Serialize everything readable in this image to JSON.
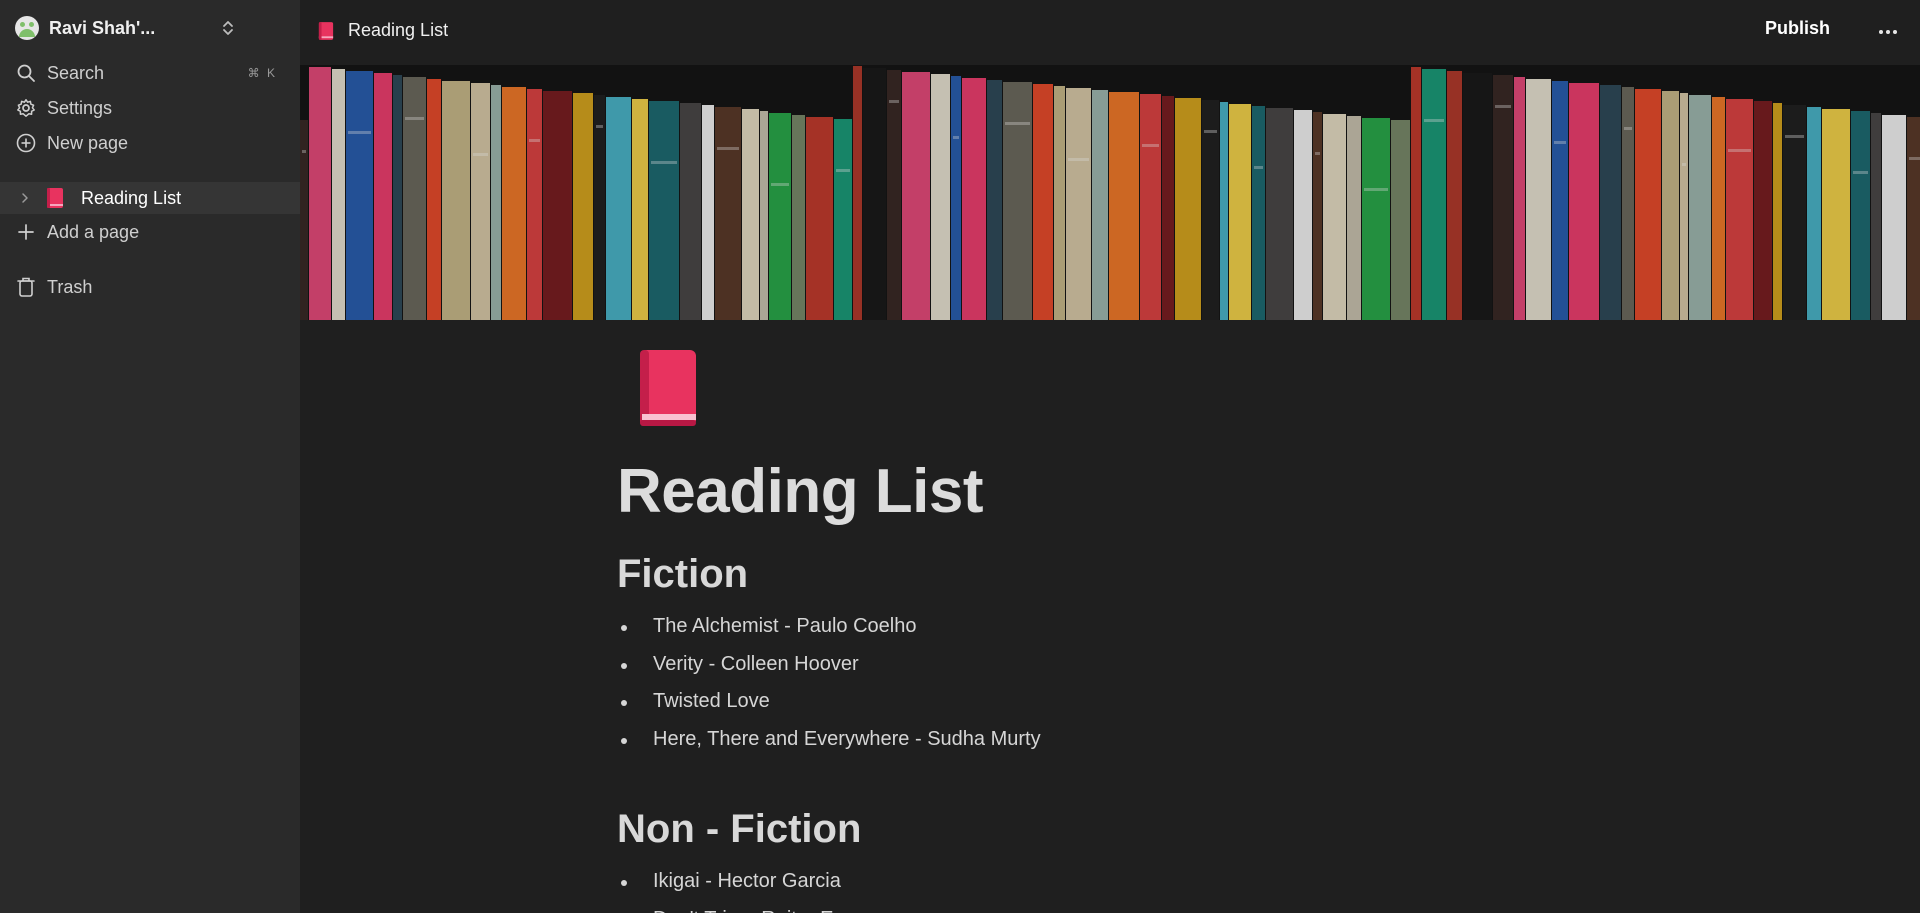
{
  "workspace": {
    "name": "Ravi Shah'..."
  },
  "sidebar": {
    "search": {
      "label": "Search",
      "shortcut": "⌘ K"
    },
    "settings": {
      "label": "Settings"
    },
    "new_page": {
      "label": "New page"
    },
    "pages": [
      {
        "label": "Reading List",
        "icon": "red-book-icon"
      }
    ],
    "add_page": {
      "label": "Add a page"
    },
    "trash": {
      "label": "Trash"
    }
  },
  "topbar": {
    "breadcrumb": "Reading List",
    "publish_label": "Publish"
  },
  "page": {
    "title": "Reading List",
    "sections": [
      {
        "heading": "Fiction",
        "items": [
          "The Alchemist - Paulo Coelho",
          "Verity - Colleen Hoover",
          "Twisted Love",
          "Here, There and Everywhere - Sudha Murty"
        ]
      },
      {
        "heading": "Non - Fiction",
        "items": [
          "Ikigai - Hector Garcia",
          "Don't Trim - Reiter Em"
        ]
      }
    ]
  },
  "colors": {
    "sidebar_bg": "#2a2a2a",
    "page_bg": "#1f1f1f",
    "book_icon": "#e8335f"
  }
}
